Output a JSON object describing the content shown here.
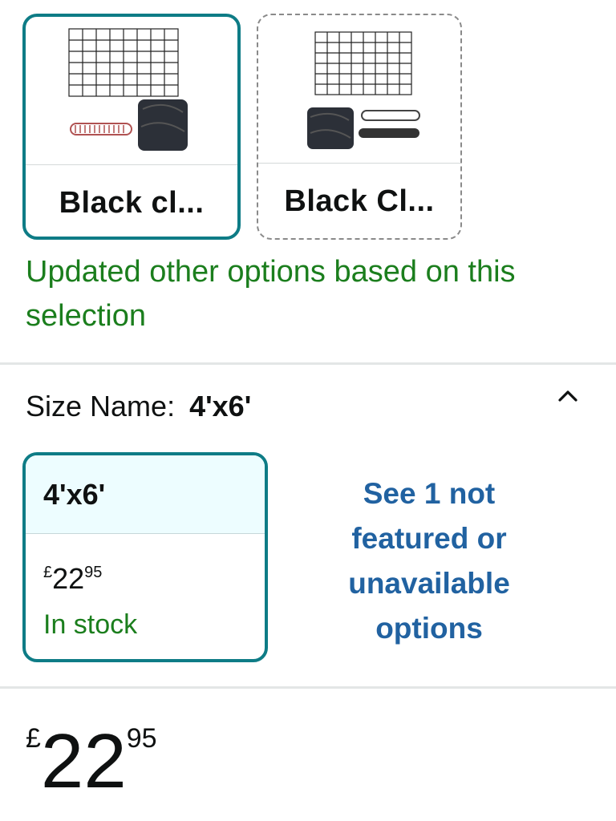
{
  "color_options": [
    {
      "label": "Black cl...",
      "selected": true
    },
    {
      "label": "Black Cl...",
      "selected": false
    }
  ],
  "update_message": "Updated other options based on this selection",
  "size": {
    "key_label": "Size Name:",
    "selected_value": "4'x6'",
    "collapse_icon": "chevron-up-icon"
  },
  "size_option": {
    "name": "4'x6'",
    "currency": "£",
    "whole": "22",
    "fraction": "95",
    "stock_status": "In stock"
  },
  "see_more_link": "See 1 not featured or unavailable options",
  "price": {
    "currency": "£",
    "whole": "22",
    "fraction": "95"
  },
  "colors": {
    "selected_border": "#0e7c86",
    "success_green": "#1b7e1d",
    "link_blue": "#2162a1",
    "selected_bg": "#edfdff"
  }
}
